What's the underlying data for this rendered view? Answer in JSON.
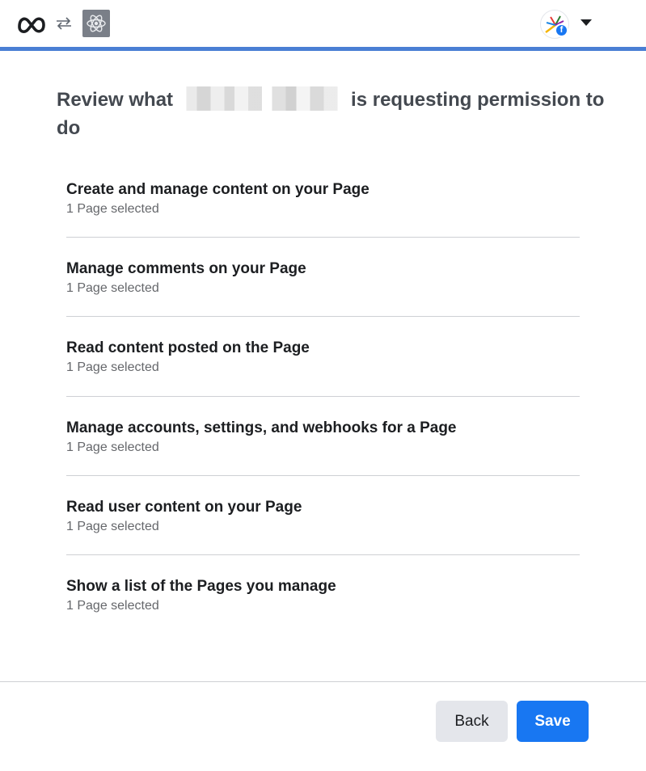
{
  "header": {
    "meta_logo_icon": "meta-infinity-logo",
    "swap_icon": "swap-arrows-icon",
    "app_icon": "atom-app-icon",
    "avatar_badge_icon": "facebook-f-icon",
    "account_menu_icon": "caret-down-icon",
    "accent_color": "#4a7fd4"
  },
  "main": {
    "heading_prefix": "Review what",
    "heading_suffix": "is requesting permission to do",
    "permissions": [
      {
        "title": "Create and manage content on your Page",
        "subtitle": "1 Page selected"
      },
      {
        "title": "Manage comments on your Page",
        "subtitle": "1 Page selected"
      },
      {
        "title": "Read content posted on the Page",
        "subtitle": "1 Page selected"
      },
      {
        "title": "Manage accounts, settings, and webhooks for a Page",
        "subtitle": "1 Page selected"
      },
      {
        "title": "Read user content on your Page",
        "subtitle": "1 Page selected"
      },
      {
        "title": "Show a list of the Pages you manage",
        "subtitle": "1 Page selected"
      }
    ]
  },
  "footer": {
    "back_label": "Back",
    "save_label": "Save",
    "save_color": "#1877f2"
  }
}
